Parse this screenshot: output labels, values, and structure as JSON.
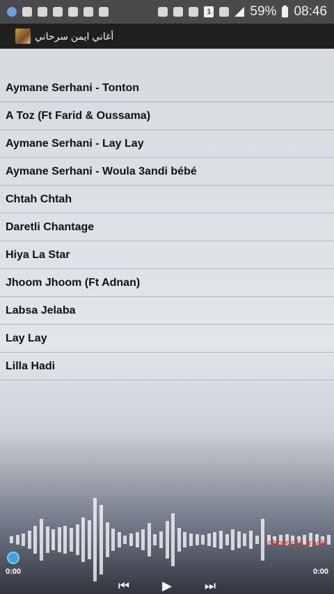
{
  "status_bar": {
    "battery_percent": "59%",
    "time": "08:46",
    "sim": "1"
  },
  "app_bar": {
    "title": "أغاني ايمن سرحاني"
  },
  "tracks": [
    "Aymane Serhani - Tonton",
    "A Toz (Ft Farid & Oussama)",
    "Aymane Serhani - Lay Lay",
    "Aymane Serhani - Woula 3andi bébé",
    "Chtah Chtah",
    "Daretli Chantage",
    "Hiya La Star",
    "Jhoom Jhoom (Ft Adnan)",
    "Labsa Jelaba",
    "Lay Lay",
    "Lilla Hadi"
  ],
  "player": {
    "choose_label": "choisir le track",
    "elapsed": "0:00",
    "duration": "0:00",
    "progress_fraction": 0
  },
  "colors": {
    "accent_red": "#ee2a2a",
    "seek_blue": "#3aa3e3"
  }
}
